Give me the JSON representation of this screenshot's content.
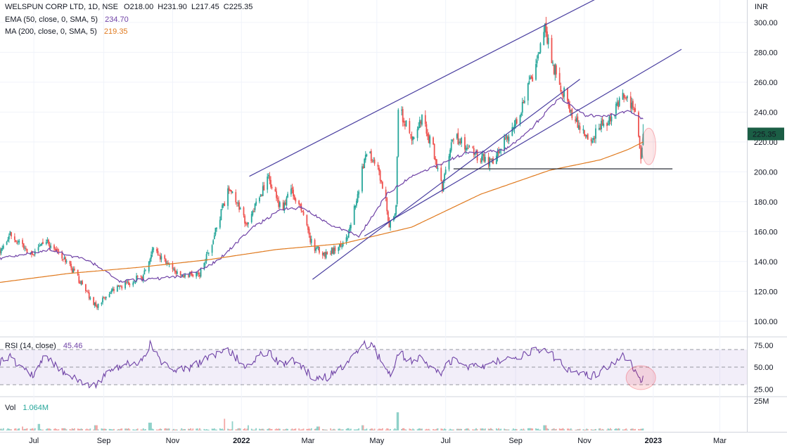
{
  "chart_data": [
    {
      "type": "candlestick",
      "symbol": "WELSPUN CORP LTD, 1D, NSE",
      "ohlc_labels": {
        "o": "O218.00",
        "h": "H231.90",
        "l": "L217.45",
        "c": "C225.35"
      },
      "currency": "INR",
      "last_price_label": "225.35",
      "ylim": [
        90,
        315
      ],
      "y_ticks": [
        "100.00",
        "120.00",
        "140.00",
        "160.00",
        "180.00",
        "200.00",
        "220.00",
        "240.00",
        "260.00",
        "280.00",
        "300.00"
      ],
      "y_tick_values": [
        100,
        120,
        140,
        160,
        180,
        200,
        220,
        240,
        260,
        280,
        300
      ],
      "x_ticks": [
        "Jul",
        "Sep",
        "Nov",
        "2022",
        "Mar",
        "May",
        "Jul",
        "Sep",
        "Nov",
        "2023",
        "Mar"
      ],
      "x_range": [
        "2021-06-01",
        "2023-03-25"
      ],
      "x_tick_dates": [
        "2021-07-01",
        "2021-09-01",
        "2021-11-01",
        "2022-01-01",
        "2022-03-01",
        "2022-05-01",
        "2022-07-01",
        "2022-09-01",
        "2022-11-01",
        "2023-01-01",
        "2023-03-01"
      ],
      "grid": true,
      "close_path": [
        [
          "2021-06-01",
          148
        ],
        [
          "2021-06-10",
          158
        ],
        [
          "2021-06-20",
          150
        ],
        [
          "2021-06-30",
          143
        ],
        [
          "2021-07-10",
          155
        ],
        [
          "2021-07-20",
          148
        ],
        [
          "2021-08-01",
          138
        ],
        [
          "2021-08-12",
          125
        ],
        [
          "2021-08-25",
          110
        ],
        [
          "2021-09-05",
          118
        ],
        [
          "2021-09-20",
          125
        ],
        [
          "2021-10-05",
          130
        ],
        [
          "2021-10-15",
          148
        ],
        [
          "2021-10-28",
          137
        ],
        [
          "2021-11-10",
          130
        ],
        [
          "2021-11-25",
          132
        ],
        [
          "2021-12-05",
          150
        ],
        [
          "2021-12-15",
          175
        ],
        [
          "2021-12-22",
          190
        ],
        [
          "2022-01-05",
          165
        ],
        [
          "2022-01-15",
          180
        ],
        [
          "2022-01-25",
          195
        ],
        [
          "2022-02-05",
          175
        ],
        [
          "2022-02-15",
          188
        ],
        [
          "2022-02-25",
          170
        ],
        [
          "2022-03-05",
          150
        ],
        [
          "2022-03-15",
          145
        ],
        [
          "2022-03-25",
          148
        ],
        [
          "2022-04-05",
          155
        ],
        [
          "2022-04-15",
          190
        ],
        [
          "2022-04-22",
          215
        ],
        [
          "2022-05-01",
          205
        ],
        [
          "2022-05-08",
          185
        ],
        [
          "2022-05-12",
          165
        ],
        [
          "2022-05-18",
          175
        ],
        [
          "2022-05-20",
          245
        ],
        [
          "2022-06-01",
          220
        ],
        [
          "2022-06-10",
          235
        ],
        [
          "2022-06-20",
          215
        ],
        [
          "2022-06-28",
          190
        ],
        [
          "2022-07-08",
          225
        ],
        [
          "2022-07-20",
          215
        ],
        [
          "2022-08-01",
          210
        ],
        [
          "2022-08-10",
          206
        ],
        [
          "2022-08-20",
          220
        ],
        [
          "2022-08-30",
          230
        ],
        [
          "2022-09-10",
          250
        ],
        [
          "2022-09-20",
          275
        ],
        [
          "2022-09-27",
          295
        ],
        [
          "2022-10-05",
          270
        ],
        [
          "2022-10-15",
          250
        ],
        [
          "2022-10-25",
          232
        ],
        [
          "2022-11-05",
          220
        ],
        [
          "2022-11-15",
          230
        ],
        [
          "2022-11-25",
          237
        ],
        [
          "2022-12-05",
          250
        ],
        [
          "2022-12-12",
          245
        ],
        [
          "2022-12-18",
          233
        ],
        [
          "2022-12-21",
          205
        ],
        [
          "2022-12-23",
          225
        ]
      ],
      "series": [
        {
          "name": "EMA (50, close, 0, SMA, 5)",
          "last_value": "234.70",
          "color": "#6f42a6",
          "points": [
            [
              "2021-06-01",
              142
            ],
            [
              "2021-07-15",
              148
            ],
            [
              "2021-08-20",
              140
            ],
            [
              "2021-09-15",
              127
            ],
            [
              "2021-10-15",
              128
            ],
            [
              "2021-11-15",
              131
            ],
            [
              "2021-12-10",
              140
            ],
            [
              "2022-01-10",
              162
            ],
            [
              "2022-02-05",
              175
            ],
            [
              "2022-02-25",
              176
            ],
            [
              "2022-03-20",
              165
            ],
            [
              "2022-04-15",
              157
            ],
            [
              "2022-05-10",
              185
            ],
            [
              "2022-06-01",
              197
            ],
            [
              "2022-06-25",
              205
            ],
            [
              "2022-07-20",
              213
            ],
            [
              "2022-08-20",
              214
            ],
            [
              "2022-09-10",
              225
            ],
            [
              "2022-10-10",
              250
            ],
            [
              "2022-11-01",
              238
            ],
            [
              "2022-11-20",
              237
            ],
            [
              "2022-12-10",
              241
            ],
            [
              "2022-12-23",
              235
            ]
          ]
        },
        {
          "name": "MA (200, close, 0, SMA, 5)",
          "last_value": "219.35",
          "color": "#e07a1f",
          "points": [
            [
              "2021-06-01",
              126
            ],
            [
              "2021-08-01",
              132
            ],
            [
              "2021-10-01",
              136
            ],
            [
              "2021-12-01",
              141
            ],
            [
              "2022-02-01",
              148
            ],
            [
              "2022-04-01",
              152
            ],
            [
              "2022-06-01",
              163
            ],
            [
              "2022-08-01",
              185
            ],
            [
              "2022-10-01",
              201
            ],
            [
              "2022-11-15",
              208
            ],
            [
              "2022-12-10",
              215
            ],
            [
              "2022-12-23",
              220
            ]
          ]
        }
      ],
      "trendlines": [
        {
          "from": [
            "2022-03-05",
            128
          ],
          "to": [
            "2022-10-28",
            262
          ]
        },
        {
          "from": [
            "2022-01-08",
            197
          ],
          "to": [
            "2022-11-12",
            316
          ]
        },
        {
          "from": [
            "2022-04-20",
            157
          ],
          "to": [
            "2023-01-26",
            282
          ]
        },
        {
          "from": [
            "2022-07-08",
            202
          ],
          "to": [
            "2023-01-18",
            202
          ]
        }
      ]
    },
    {
      "type": "line",
      "title": "RSI",
      "legend_label": "RSI (14, close)",
      "legend_value": "45.46",
      "y_ticks": [
        "25.00",
        "50.00",
        "75.00"
      ],
      "y_tick_values": [
        25,
        50,
        75
      ],
      "ylim": [
        18,
        82
      ],
      "band": [
        30,
        70
      ],
      "color": "#6f42a6",
      "points": [
        [
          "2021-06-01",
          55
        ],
        [
          "2021-06-10",
          62
        ],
        [
          "2021-06-20",
          50
        ],
        [
          "2021-07-01",
          42
        ],
        [
          "2021-07-10",
          65
        ],
        [
          "2021-07-20",
          52
        ],
        [
          "2021-08-01",
          40
        ],
        [
          "2021-08-15",
          32
        ],
        [
          "2021-08-25",
          28
        ],
        [
          "2021-09-05",
          45
        ],
        [
          "2021-09-20",
          55
        ],
        [
          "2021-10-05",
          58
        ],
        [
          "2021-10-12",
          75
        ],
        [
          "2021-10-25",
          52
        ],
        [
          "2021-11-05",
          45
        ],
        [
          "2021-11-20",
          52
        ],
        [
          "2021-12-05",
          62
        ],
        [
          "2021-12-18",
          72
        ],
        [
          "2022-01-05",
          50
        ],
        [
          "2022-01-15",
          62
        ],
        [
          "2022-01-25",
          68
        ],
        [
          "2022-02-05",
          52
        ],
        [
          "2022-02-15",
          58
        ],
        [
          "2022-02-28",
          45
        ],
        [
          "2022-03-10",
          35
        ],
        [
          "2022-03-20",
          40
        ],
        [
          "2022-04-01",
          50
        ],
        [
          "2022-04-10",
          62
        ],
        [
          "2022-04-18",
          77
        ],
        [
          "2022-04-28",
          72
        ],
        [
          "2022-05-10",
          45
        ],
        [
          "2022-05-15",
          40
        ],
        [
          "2022-05-20",
          68
        ],
        [
          "2022-06-01",
          55
        ],
        [
          "2022-06-10",
          62
        ],
        [
          "2022-06-25",
          42
        ],
        [
          "2022-07-08",
          60
        ],
        [
          "2022-07-20",
          52
        ],
        [
          "2022-08-05",
          50
        ],
        [
          "2022-08-20",
          58
        ],
        [
          "2022-09-05",
          62
        ],
        [
          "2022-09-20",
          70
        ],
        [
          "2022-09-27",
          72
        ],
        [
          "2022-10-10",
          55
        ],
        [
          "2022-10-25",
          42
        ],
        [
          "2022-11-10",
          40
        ],
        [
          "2022-11-25",
          55
        ],
        [
          "2022-12-05",
          62
        ],
        [
          "2022-12-15",
          50
        ],
        [
          "2022-12-20",
          35
        ],
        [
          "2022-12-21",
          28
        ],
        [
          "2022-12-23",
          45
        ]
      ]
    },
    {
      "type": "bar",
      "title": "Vol",
      "legend_label": "Vol",
      "legend_value": "1.064M",
      "y_ticks": [
        "25M"
      ],
      "ylim": [
        0,
        25
      ],
      "spikes": [
        [
          "2021-06-20",
          3
        ],
        [
          "2021-07-05",
          5
        ],
        [
          "2021-08-25",
          4
        ],
        [
          "2021-10-12",
          6
        ],
        [
          "2021-12-18",
          9
        ],
        [
          "2021-12-25",
          7
        ],
        [
          "2022-01-08",
          4
        ],
        [
          "2022-03-10",
          3
        ],
        [
          "2022-04-18",
          4
        ],
        [
          "2022-05-20",
          14
        ],
        [
          "2022-09-27",
          4
        ]
      ],
      "base_value": 1.1
    }
  ]
}
